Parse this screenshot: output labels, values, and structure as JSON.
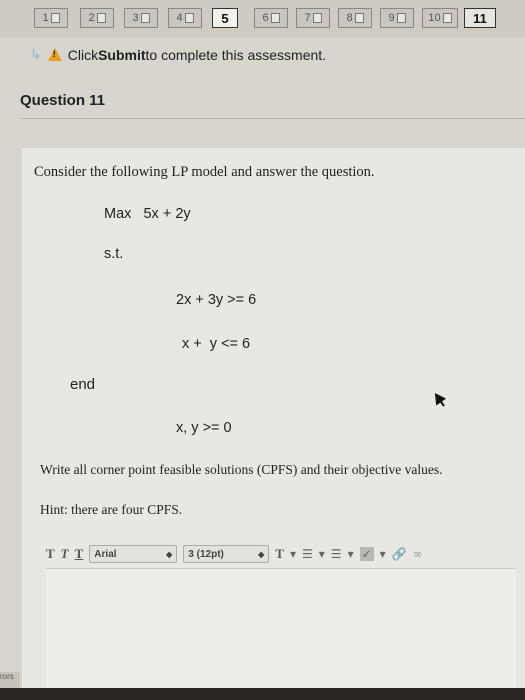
{
  "nav": {
    "questions": [
      {
        "label": "1"
      },
      {
        "label": "2"
      },
      {
        "label": "3"
      },
      {
        "label": "4"
      },
      {
        "label": "5"
      },
      {
        "label": "6"
      },
      {
        "label": "7"
      },
      {
        "label": "8"
      },
      {
        "label": "9"
      },
      {
        "label": "10"
      },
      {
        "label": "11"
      }
    ],
    "current": "5",
    "last": "11"
  },
  "notice": {
    "pre": "Click ",
    "bold": "Submit",
    "post": " to complete this assessment."
  },
  "question": {
    "title": "Question 11",
    "intro": "Consider the following LP model and answer the question.",
    "objective": "Max   5x + 2y",
    "st": "s.t.",
    "constraint1": "2x + 3y >= 6",
    "constraint2": "x +  y <= 6",
    "end": "end",
    "nonneg": "x, y >= 0",
    "prompt": "Write all corner point feasible solutions (CPFS) and their objective values.",
    "hint": "Hint: there are four CPFS."
  },
  "editor": {
    "bold_glyph": "T",
    "italic_glyph": "T",
    "underline_glyph": "T",
    "font_family": "Arial",
    "font_size": "3 (12pt)",
    "text_color_glyph": "T"
  },
  "side_fragment": "rors",
  "icons": [
    "arrow-icon",
    "warning-icon",
    "file-icon",
    "caret-icon",
    "list-bullets-icon",
    "list-numbers-icon",
    "spellcheck-icon",
    "link-icon",
    "unlink-icon"
  ]
}
